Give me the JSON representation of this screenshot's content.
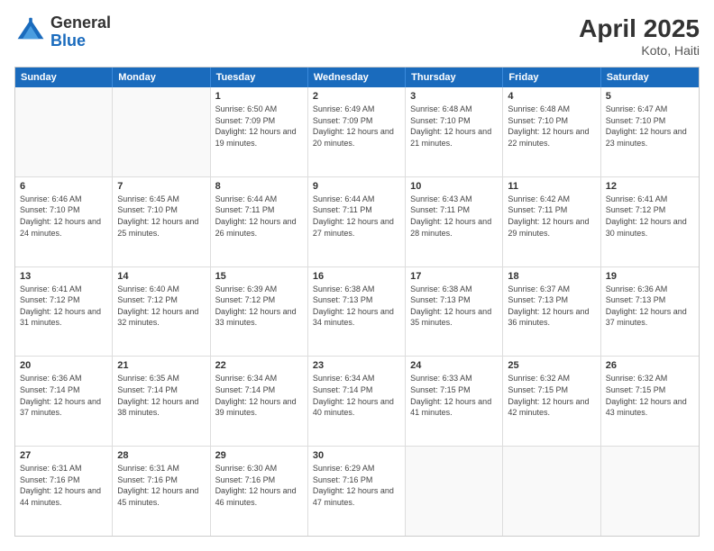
{
  "header": {
    "logo_general": "General",
    "logo_blue": "Blue",
    "month_title": "April 2025",
    "location": "Koto, Haiti"
  },
  "days_of_week": [
    "Sunday",
    "Monday",
    "Tuesday",
    "Wednesday",
    "Thursday",
    "Friday",
    "Saturday"
  ],
  "weeks": [
    [
      {
        "day": "",
        "sunrise": "",
        "sunset": "",
        "daylight": "",
        "empty": true
      },
      {
        "day": "",
        "sunrise": "",
        "sunset": "",
        "daylight": "",
        "empty": true
      },
      {
        "day": "1",
        "sunrise": "Sunrise: 6:50 AM",
        "sunset": "Sunset: 7:09 PM",
        "daylight": "Daylight: 12 hours and 19 minutes.",
        "empty": false
      },
      {
        "day": "2",
        "sunrise": "Sunrise: 6:49 AM",
        "sunset": "Sunset: 7:09 PM",
        "daylight": "Daylight: 12 hours and 20 minutes.",
        "empty": false
      },
      {
        "day": "3",
        "sunrise": "Sunrise: 6:48 AM",
        "sunset": "Sunset: 7:10 PM",
        "daylight": "Daylight: 12 hours and 21 minutes.",
        "empty": false
      },
      {
        "day": "4",
        "sunrise": "Sunrise: 6:48 AM",
        "sunset": "Sunset: 7:10 PM",
        "daylight": "Daylight: 12 hours and 22 minutes.",
        "empty": false
      },
      {
        "day": "5",
        "sunrise": "Sunrise: 6:47 AM",
        "sunset": "Sunset: 7:10 PM",
        "daylight": "Daylight: 12 hours and 23 minutes.",
        "empty": false
      }
    ],
    [
      {
        "day": "6",
        "sunrise": "Sunrise: 6:46 AM",
        "sunset": "Sunset: 7:10 PM",
        "daylight": "Daylight: 12 hours and 24 minutes.",
        "empty": false
      },
      {
        "day": "7",
        "sunrise": "Sunrise: 6:45 AM",
        "sunset": "Sunset: 7:10 PM",
        "daylight": "Daylight: 12 hours and 25 minutes.",
        "empty": false
      },
      {
        "day": "8",
        "sunrise": "Sunrise: 6:44 AM",
        "sunset": "Sunset: 7:11 PM",
        "daylight": "Daylight: 12 hours and 26 minutes.",
        "empty": false
      },
      {
        "day": "9",
        "sunrise": "Sunrise: 6:44 AM",
        "sunset": "Sunset: 7:11 PM",
        "daylight": "Daylight: 12 hours and 27 minutes.",
        "empty": false
      },
      {
        "day": "10",
        "sunrise": "Sunrise: 6:43 AM",
        "sunset": "Sunset: 7:11 PM",
        "daylight": "Daylight: 12 hours and 28 minutes.",
        "empty": false
      },
      {
        "day": "11",
        "sunrise": "Sunrise: 6:42 AM",
        "sunset": "Sunset: 7:11 PM",
        "daylight": "Daylight: 12 hours and 29 minutes.",
        "empty": false
      },
      {
        "day": "12",
        "sunrise": "Sunrise: 6:41 AM",
        "sunset": "Sunset: 7:12 PM",
        "daylight": "Daylight: 12 hours and 30 minutes.",
        "empty": false
      }
    ],
    [
      {
        "day": "13",
        "sunrise": "Sunrise: 6:41 AM",
        "sunset": "Sunset: 7:12 PM",
        "daylight": "Daylight: 12 hours and 31 minutes.",
        "empty": false
      },
      {
        "day": "14",
        "sunrise": "Sunrise: 6:40 AM",
        "sunset": "Sunset: 7:12 PM",
        "daylight": "Daylight: 12 hours and 32 minutes.",
        "empty": false
      },
      {
        "day": "15",
        "sunrise": "Sunrise: 6:39 AM",
        "sunset": "Sunset: 7:12 PM",
        "daylight": "Daylight: 12 hours and 33 minutes.",
        "empty": false
      },
      {
        "day": "16",
        "sunrise": "Sunrise: 6:38 AM",
        "sunset": "Sunset: 7:13 PM",
        "daylight": "Daylight: 12 hours and 34 minutes.",
        "empty": false
      },
      {
        "day": "17",
        "sunrise": "Sunrise: 6:38 AM",
        "sunset": "Sunset: 7:13 PM",
        "daylight": "Daylight: 12 hours and 35 minutes.",
        "empty": false
      },
      {
        "day": "18",
        "sunrise": "Sunrise: 6:37 AM",
        "sunset": "Sunset: 7:13 PM",
        "daylight": "Daylight: 12 hours and 36 minutes.",
        "empty": false
      },
      {
        "day": "19",
        "sunrise": "Sunrise: 6:36 AM",
        "sunset": "Sunset: 7:13 PM",
        "daylight": "Daylight: 12 hours and 37 minutes.",
        "empty": false
      }
    ],
    [
      {
        "day": "20",
        "sunrise": "Sunrise: 6:36 AM",
        "sunset": "Sunset: 7:14 PM",
        "daylight": "Daylight: 12 hours and 37 minutes.",
        "empty": false
      },
      {
        "day": "21",
        "sunrise": "Sunrise: 6:35 AM",
        "sunset": "Sunset: 7:14 PM",
        "daylight": "Daylight: 12 hours and 38 minutes.",
        "empty": false
      },
      {
        "day": "22",
        "sunrise": "Sunrise: 6:34 AM",
        "sunset": "Sunset: 7:14 PM",
        "daylight": "Daylight: 12 hours and 39 minutes.",
        "empty": false
      },
      {
        "day": "23",
        "sunrise": "Sunrise: 6:34 AM",
        "sunset": "Sunset: 7:14 PM",
        "daylight": "Daylight: 12 hours and 40 minutes.",
        "empty": false
      },
      {
        "day": "24",
        "sunrise": "Sunrise: 6:33 AM",
        "sunset": "Sunset: 7:15 PM",
        "daylight": "Daylight: 12 hours and 41 minutes.",
        "empty": false
      },
      {
        "day": "25",
        "sunrise": "Sunrise: 6:32 AM",
        "sunset": "Sunset: 7:15 PM",
        "daylight": "Daylight: 12 hours and 42 minutes.",
        "empty": false
      },
      {
        "day": "26",
        "sunrise": "Sunrise: 6:32 AM",
        "sunset": "Sunset: 7:15 PM",
        "daylight": "Daylight: 12 hours and 43 minutes.",
        "empty": false
      }
    ],
    [
      {
        "day": "27",
        "sunrise": "Sunrise: 6:31 AM",
        "sunset": "Sunset: 7:16 PM",
        "daylight": "Daylight: 12 hours and 44 minutes.",
        "empty": false
      },
      {
        "day": "28",
        "sunrise": "Sunrise: 6:31 AM",
        "sunset": "Sunset: 7:16 PM",
        "daylight": "Daylight: 12 hours and 45 minutes.",
        "empty": false
      },
      {
        "day": "29",
        "sunrise": "Sunrise: 6:30 AM",
        "sunset": "Sunset: 7:16 PM",
        "daylight": "Daylight: 12 hours and 46 minutes.",
        "empty": false
      },
      {
        "day": "30",
        "sunrise": "Sunrise: 6:29 AM",
        "sunset": "Sunset: 7:16 PM",
        "daylight": "Daylight: 12 hours and 47 minutes.",
        "empty": false
      },
      {
        "day": "",
        "sunrise": "",
        "sunset": "",
        "daylight": "",
        "empty": true
      },
      {
        "day": "",
        "sunrise": "",
        "sunset": "",
        "daylight": "",
        "empty": true
      },
      {
        "day": "",
        "sunrise": "",
        "sunset": "",
        "daylight": "",
        "empty": true
      }
    ]
  ]
}
